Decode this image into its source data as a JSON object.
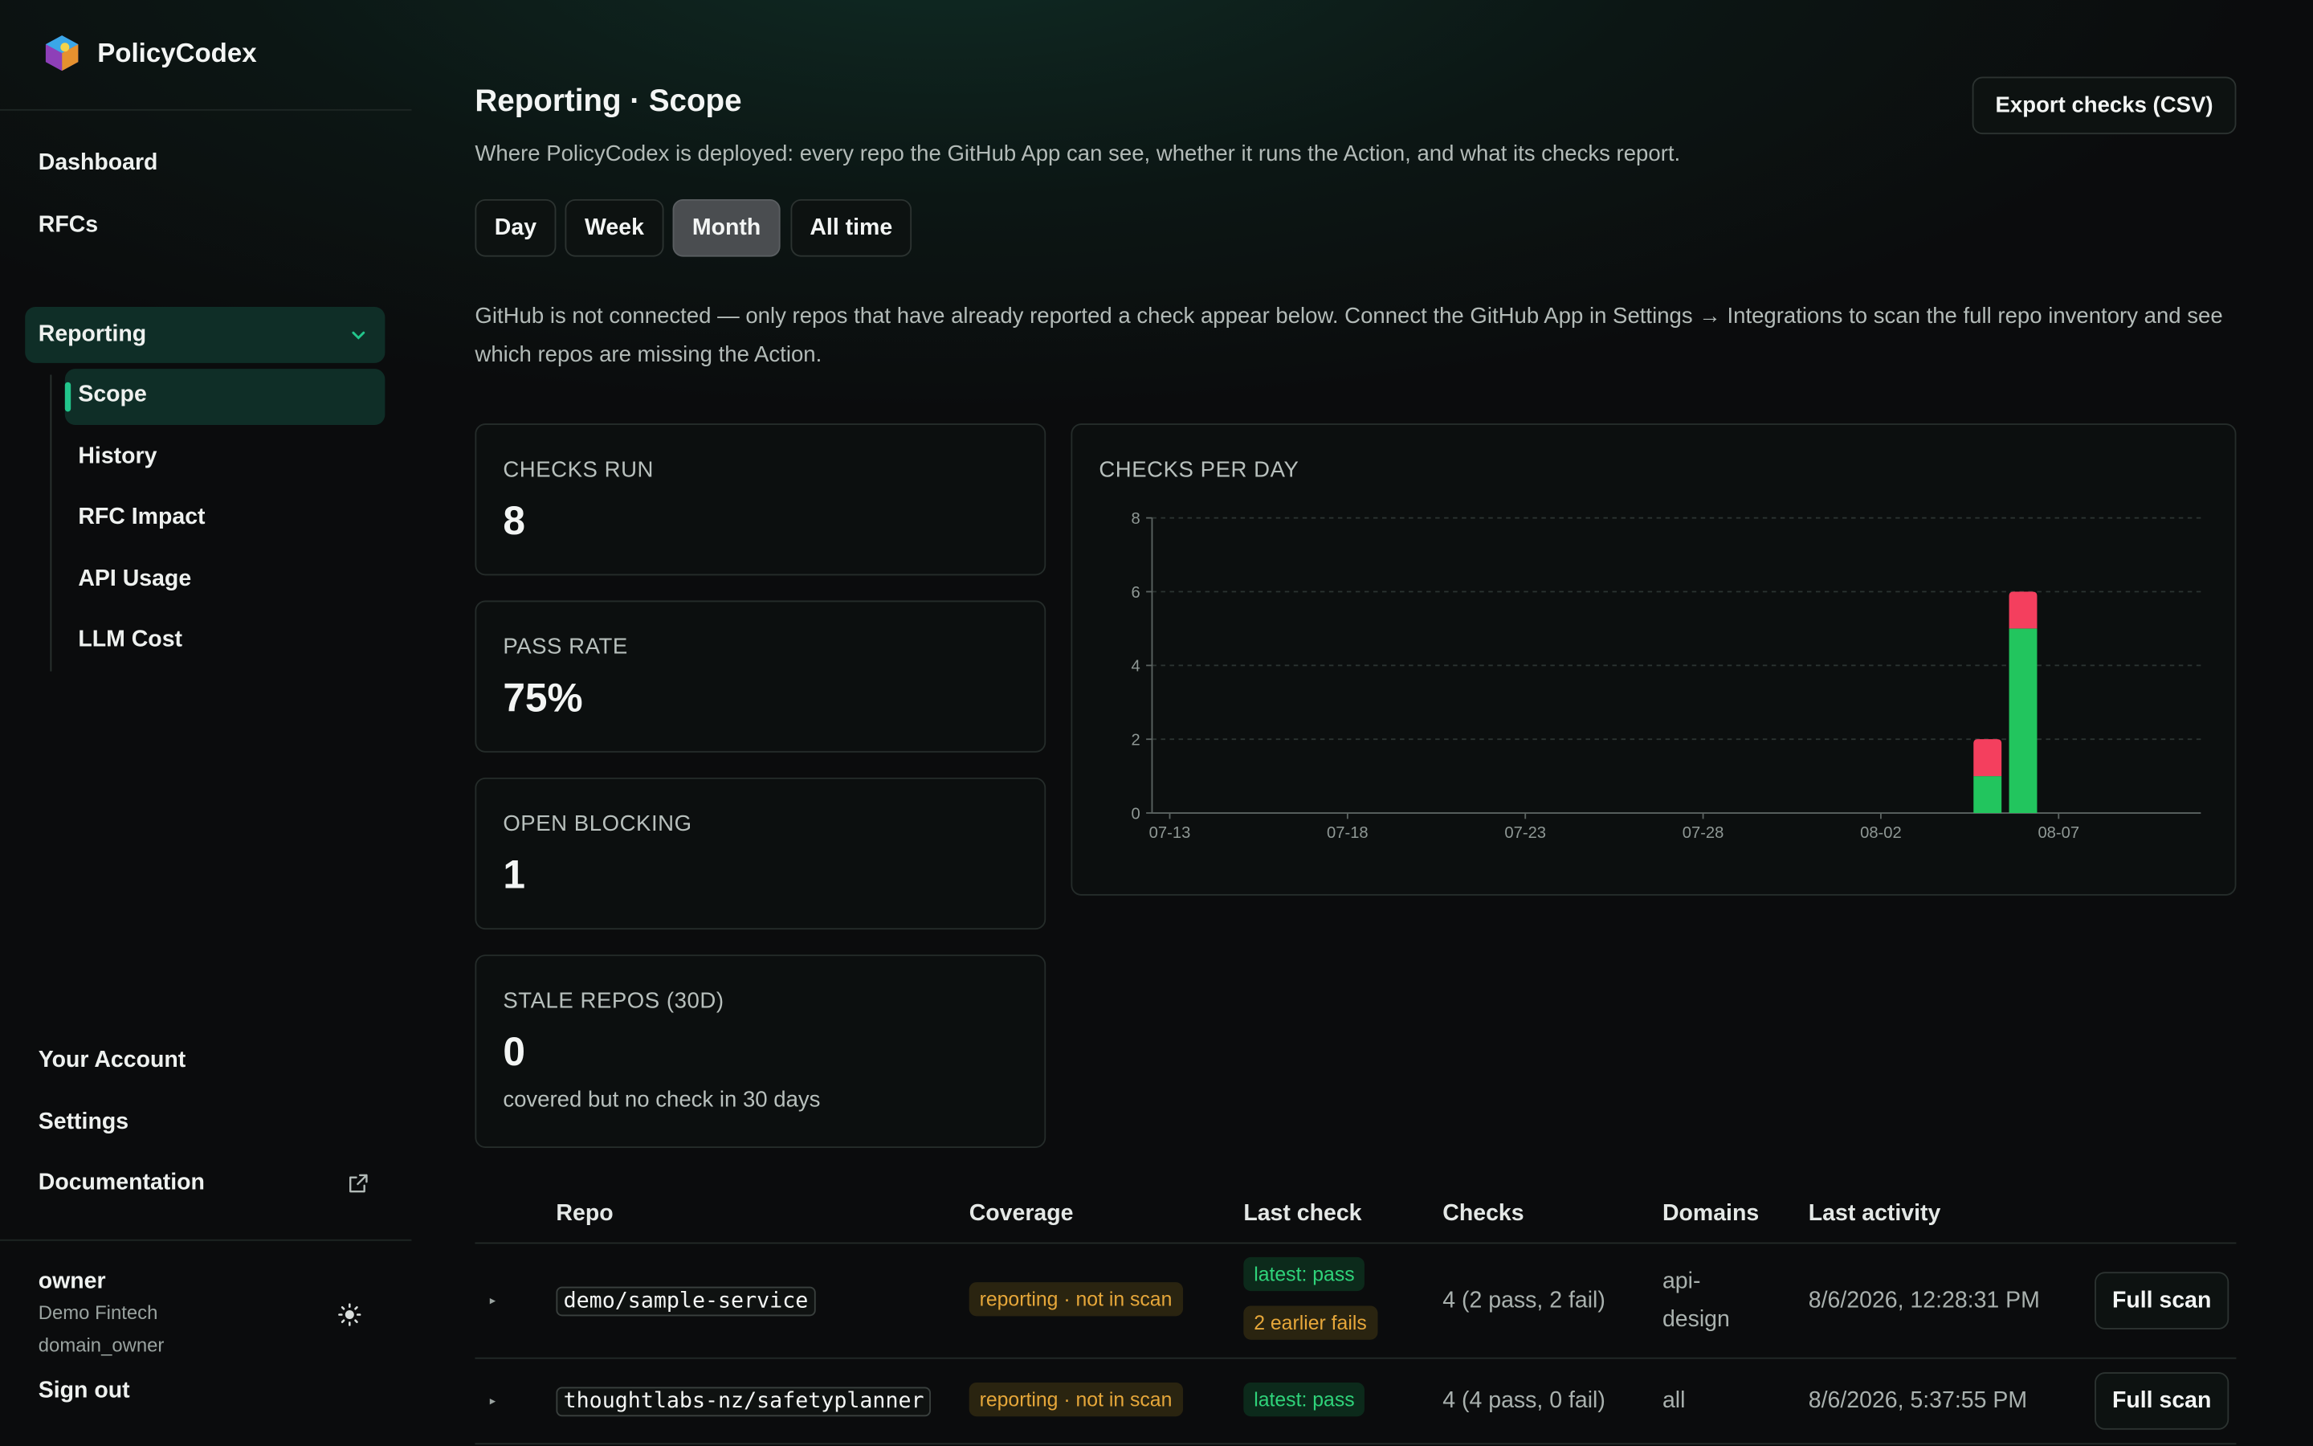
{
  "brand": {
    "name": "PolicyCodex"
  },
  "nav": {
    "dashboard": "Dashboard",
    "rfcs": "RFCs",
    "reporting": "Reporting",
    "sub": [
      "Scope",
      "History",
      "RFC Impact",
      "API Usage",
      "LLM Cost"
    ],
    "your_account": "Your Account",
    "settings": "Settings",
    "documentation": "Documentation"
  },
  "user": {
    "name": "owner",
    "org": "Demo Fintech",
    "role": "domain_owner",
    "sign_out": "Sign out"
  },
  "header": {
    "title": "Reporting · Scope",
    "description": "Where PolicyCodex is deployed: every repo the GitHub App can see, whether it runs the Action, and what its checks report.",
    "export_label": "Export checks (CSV)"
  },
  "ranges": [
    "Day",
    "Week",
    "Month",
    "All time"
  ],
  "selected_range": "Month",
  "notice": "GitHub is not connected — only repos that have already reported a check appear below. Connect the GitHub App in Settings → Integrations to scan the full repo inventory and see which repos are missing the Action.",
  "stats": [
    {
      "label": "CHECKS RUN",
      "value": "8"
    },
    {
      "label": "PASS RATE",
      "value": "75%"
    },
    {
      "label": "OPEN BLOCKING",
      "value": "1"
    },
    {
      "label": "STALE REPOS (30D)",
      "value": "0",
      "note": "covered but no check in 30 days"
    }
  ],
  "chart_title": "CHECKS PER DAY",
  "chart_data": {
    "type": "bar",
    "stacked": true,
    "x": [
      "08-05",
      "08-06"
    ],
    "x_tick_labels": [
      "07-13",
      "07-18",
      "07-23",
      "07-28",
      "08-02",
      "08-07"
    ],
    "x_range": [
      "07-13",
      "08-11"
    ],
    "series": [
      {
        "color": "#22c55e",
        "values": [
          1,
          5
        ]
      },
      {
        "color": "#f43f5e",
        "values": [
          1,
          1
        ]
      }
    ],
    "ylim": [
      0,
      8
    ],
    "y_ticks": [
      0,
      2,
      4,
      6,
      8
    ],
    "grid": true
  },
  "table": {
    "headers": [
      "Repo",
      "Coverage",
      "Last check",
      "Checks",
      "Domains",
      "Last activity"
    ],
    "rows": [
      {
        "repo": "demo/sample-service",
        "coverage": "reporting · not in scan",
        "last_check": "latest: pass",
        "last_check_extra": "2 earlier fails",
        "checks": "4 (2 pass, 2 fail)",
        "domains": [
          "api-",
          "design"
        ],
        "last_activity": "8/6/2026, 12:28:31 PM",
        "action": "Full scan"
      },
      {
        "repo": "thoughtlabs-nz/safetyplanner",
        "coverage": "reporting · not in scan",
        "last_check": "latest: pass",
        "checks": "4 (4 pass, 0 fail)",
        "domains": [
          "all"
        ],
        "last_activity": "8/6/2026, 5:37:55 PM",
        "action": "Full scan"
      }
    ]
  },
  "colors": {
    "accent": "#22c58b",
    "pass": "#22c55e",
    "fail": "#f43f5e",
    "warn": "#e6a73a"
  }
}
